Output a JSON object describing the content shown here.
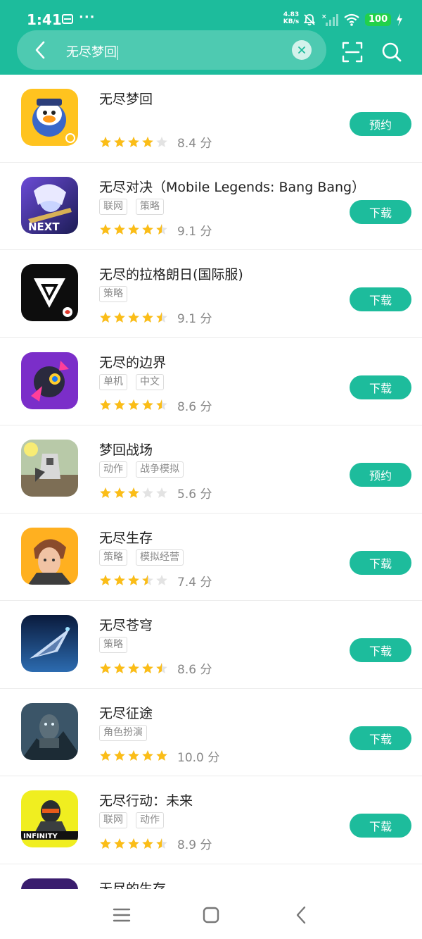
{
  "status_bar": {
    "time": "1:41",
    "dots": "···",
    "net_speed_value": "4.83",
    "net_speed_unit": "KB/s",
    "battery": "100"
  },
  "search": {
    "query": "无尽梦回"
  },
  "apps": [
    {
      "name": "无尽梦回",
      "tags": [],
      "stars": 4,
      "score": "8.4 分",
      "action": "预约"
    },
    {
      "name": "无尽对决（Mobile Legends: Bang Bang）",
      "tags": [
        "联网",
        "策略"
      ],
      "stars": 4.5,
      "score": "9.1 分",
      "action": "下载"
    },
    {
      "name": "无尽的拉格朗日(国际服)",
      "tags": [
        "策略"
      ],
      "stars": 4.5,
      "score": "9.1 分",
      "action": "下载"
    },
    {
      "name": "无尽的边界",
      "tags": [
        "单机",
        "中文"
      ],
      "stars": 4.5,
      "score": "8.6 分",
      "action": "下载"
    },
    {
      "name": "梦回战场",
      "tags": [
        "动作",
        "战争模拟"
      ],
      "stars": 3,
      "score": "5.6 分",
      "action": "预约"
    },
    {
      "name": "无尽生存",
      "tags": [
        "策略",
        "模拟经营"
      ],
      "stars": 3.5,
      "score": "7.4 分",
      "action": "下载"
    },
    {
      "name": "无尽苍穹",
      "tags": [
        "策略"
      ],
      "stars": 4.5,
      "score": "8.6 分",
      "action": "下载"
    },
    {
      "name": "无尽征途",
      "tags": [
        "角色扮演"
      ],
      "stars": 5,
      "score": "10.0 分",
      "action": "下载"
    },
    {
      "name": "无尽行动：未来",
      "tags": [
        "联网",
        "动作"
      ],
      "stars": 4.5,
      "score": "8.9 分",
      "action": "下载"
    },
    {
      "name": "无尽的生存",
      "tags": [],
      "stars": 0,
      "score": "",
      "action": ""
    }
  ],
  "icon_labels": {
    "mobile_legends": "NEXT",
    "infinity_ops": "INFINITY"
  },
  "colors": {
    "accent": "#1dbc9c",
    "star_full": "#fbbd17",
    "star_empty": "#e3e3e3"
  }
}
